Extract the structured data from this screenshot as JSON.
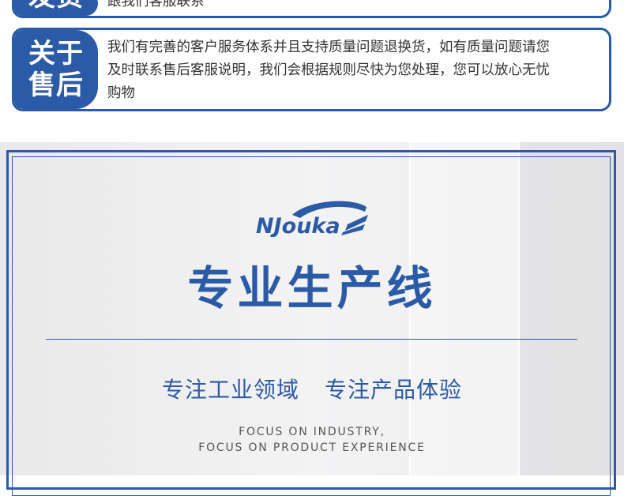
{
  "card_top": {
    "tag_label": "发货",
    "text": "跟我们客服联系"
  },
  "card_after_sales": {
    "tag_line1": "关于",
    "tag_line2": "售后",
    "text_line1": "我们有完善的客户服务体系并且支持质量问题退换货，如有质量问题请您",
    "text_line2": "及时联系售后客服说明，我们会根据规则尽快为您处理，您可以放心无忧",
    "text_line3": "购物"
  },
  "banner": {
    "logo_text": "NJouka",
    "title": "专业生产线",
    "slogan_1": "专注工业领域",
    "slogan_2": "专注产品体验",
    "en_line1": "FOCUS ON INDUSTRY,",
    "en_line2": "FOCUS ON PRODUCT EXPERIENCE"
  },
  "colors": {
    "brand_blue": "#2b5aa6",
    "body_text": "#333333",
    "panel_bg": "#eeeeef"
  }
}
